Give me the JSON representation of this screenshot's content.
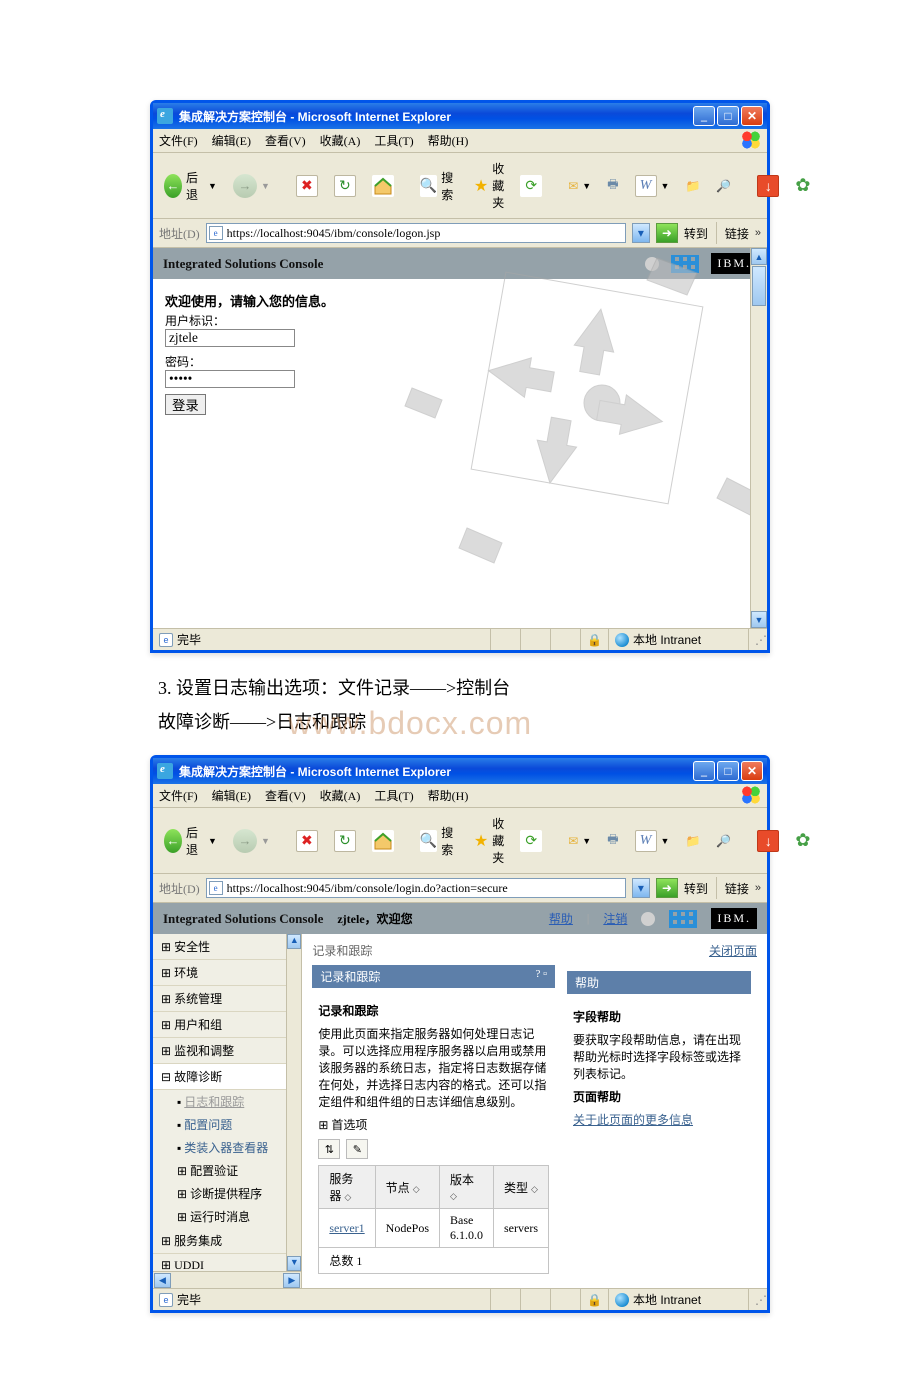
{
  "win1": {
    "title": "集成解决方案控制台 - Microsoft Internet Explorer",
    "menu": {
      "file": "文件(F)",
      "edit": "编辑(E)",
      "view": "查看(V)",
      "fav": "收藏(A)",
      "tools": "工具(T)",
      "help": "帮助(H)"
    },
    "toolbar": {
      "back": "后退",
      "search": "搜索",
      "favorites": "收藏夹"
    },
    "addr": {
      "label": "地址(D)",
      "url": "https://localhost:9045/ibm/console/logon.jsp",
      "go": "转到",
      "links": "链接"
    },
    "isc_title": "Integrated Solutions Console",
    "ibm": "IBM.",
    "login": {
      "welcome": "欢迎使用，请输入您的信息。",
      "user_label": "用户标识：",
      "user_value": "zjtele",
      "pass_label": "密码：",
      "pass_value": "●●●●●",
      "submit": "登录"
    },
    "status": {
      "done": "完毕",
      "zone": "本地 Intranet"
    }
  },
  "doc": {
    "line1": "3. 设置日志输出选项：文件记录——>控制台",
    "line2_a": "故障诊断——>日志和跟踪",
    "watermark": "www.bdocx.com"
  },
  "win2": {
    "title": "集成解决方案控制台 - Microsoft Internet Explorer",
    "menu": {
      "file": "文件(F)",
      "edit": "编辑(E)",
      "view": "查看(V)",
      "fav": "收藏(A)",
      "tools": "工具(T)",
      "help": "帮助(H)"
    },
    "toolbar": {
      "back": "后退",
      "search": "搜索",
      "favorites": "收藏夹"
    },
    "addr": {
      "label": "地址(D)",
      "url": "https://localhost:9045/ibm/console/login.do?action=secure",
      "go": "转到",
      "links": "链接"
    },
    "isc_title": "Integrated Solutions Console",
    "welcome": "zjtele，欢迎您",
    "help_link": "帮助",
    "logout_link": "注销",
    "ibm": "IBM.",
    "sidebar": {
      "items": [
        "安全性",
        "环境",
        "系统管理",
        "用户和组",
        "监视和调整"
      ],
      "diag": "故障诊断",
      "sub1": "日志和跟踪",
      "sub2": "配置问题",
      "sub3": "类装入器查看器",
      "sub4": "配置验证",
      "sub5": "诊断提供程序",
      "sub6": "运行时消息",
      "svc": "服务集成",
      "uddi": "UDDI"
    },
    "crumb": "记录和跟踪",
    "close_page": "关闭页面",
    "panel_title": "记录和跟踪",
    "panel_sub": "记录和跟踪",
    "panel_desc": "使用此页面来指定服务器如何处理日志记录。可以选择应用程序服务器以启用或禁用该服务器的系统日志，指定将日志数据存储在何处，并选择日志内容的格式。还可以指定组件和组件组的日志详细信息级别。",
    "prefs": "首选项",
    "table": {
      "headers": [
        "服务器",
        "节点",
        "版本",
        "类型"
      ],
      "row": [
        "server1",
        "NodePos",
        "Base 6.1.0.0",
        "servers"
      ],
      "total": "总数 1"
    },
    "help": {
      "title": "帮助",
      "field_title": "字段帮助",
      "field_text": "要获取字段帮助信息，请在出现帮助光标时选择字段标签或选择列表标记。",
      "page_title": "页面帮助",
      "page_link": "关于此页面的更多信息"
    },
    "status": {
      "done": "完毕",
      "zone": "本地 Intranet"
    }
  }
}
